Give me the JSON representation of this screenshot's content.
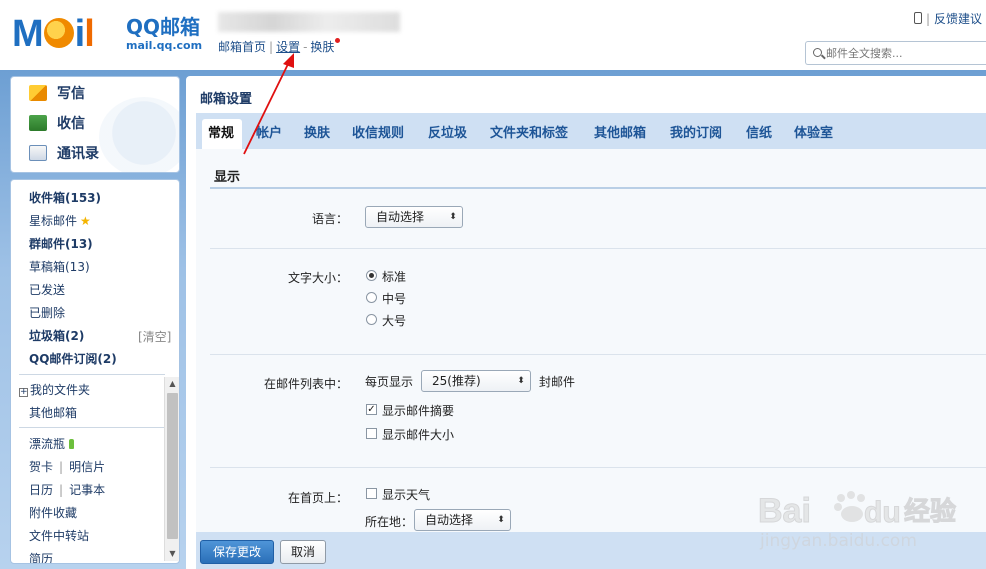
{
  "header": {
    "logo_brand": "MOil",
    "logo_title": "QQ邮箱",
    "logo_domain": "mail.qq.com",
    "nav": {
      "home": "邮箱首页",
      "sep1": "|",
      "settings": "设置",
      "sep2": "-",
      "skin": "换肤"
    },
    "feedback": {
      "sep": "|",
      "label": "反馈建议"
    },
    "search": {
      "placeholder": "邮件全文搜索..."
    }
  },
  "sidebar": {
    "actions": [
      {
        "label": "写信",
        "icon": "compose-icon"
      },
      {
        "label": "收信",
        "icon": "inbox-download-icon"
      },
      {
        "label": "通讯录",
        "icon": "address-book-icon"
      }
    ],
    "folders": {
      "inbox": "收件箱(153)",
      "starred": "星标邮件",
      "group": "群邮件(13)",
      "drafts": "草稿箱(13)",
      "sent": "已发送",
      "deleted": "已删除",
      "trash": "垃圾箱(2)",
      "trash_clear": "[清空]",
      "subscriptions": "QQ邮件订阅(2)",
      "my_folders": "我的文件夹",
      "other_mailboxes": "其他邮箱",
      "drift_bottle": "漂流瓶",
      "cards": "贺卡",
      "postcards": "明信片",
      "calendar": "日历",
      "notebook": "记事本",
      "attachments": "附件收藏",
      "file_transfer": "文件中转站",
      "resume": "简历"
    }
  },
  "main": {
    "title": "邮箱设置",
    "tabs": [
      "常规",
      "帐户",
      "换肤",
      "收信规则",
      "反垃圾",
      "文件夹和标签",
      "其他邮箱",
      "我的订阅",
      "信纸",
      "体验室"
    ],
    "active_tab": "常规",
    "section": "显示",
    "language": {
      "label": "语言：",
      "value": "自动选择"
    },
    "font_size": {
      "label": "文字大小：",
      "options": [
        "标准",
        "中号",
        "大号"
      ],
      "selected": "标准"
    },
    "mail_list": {
      "label": "在邮件列表中：",
      "per_page_prefix": "每页显示",
      "per_page_value": "25(推荐)",
      "per_page_suffix": "封邮件",
      "show_summary": "显示邮件摘要",
      "show_summary_checked": true,
      "show_size": "显示邮件大小",
      "show_size_checked": false
    },
    "homepage": {
      "label": "在首页上：",
      "show_weather": "显示天气",
      "show_weather_checked": false,
      "location_label": "所在地：",
      "location_value": "自动选择"
    },
    "buttons": {
      "save": "保存更改",
      "cancel": "取消"
    }
  },
  "watermark": {
    "brand": "Bai",
    "brand2": "du",
    "cn": "经验",
    "url": "jingyan.baidu.com"
  },
  "colors": {
    "accent": "#1f6fc1",
    "tab_bg": "#cfe0f3",
    "annotation_arrow": "#e01010",
    "save_button": "#2a6fb8"
  }
}
